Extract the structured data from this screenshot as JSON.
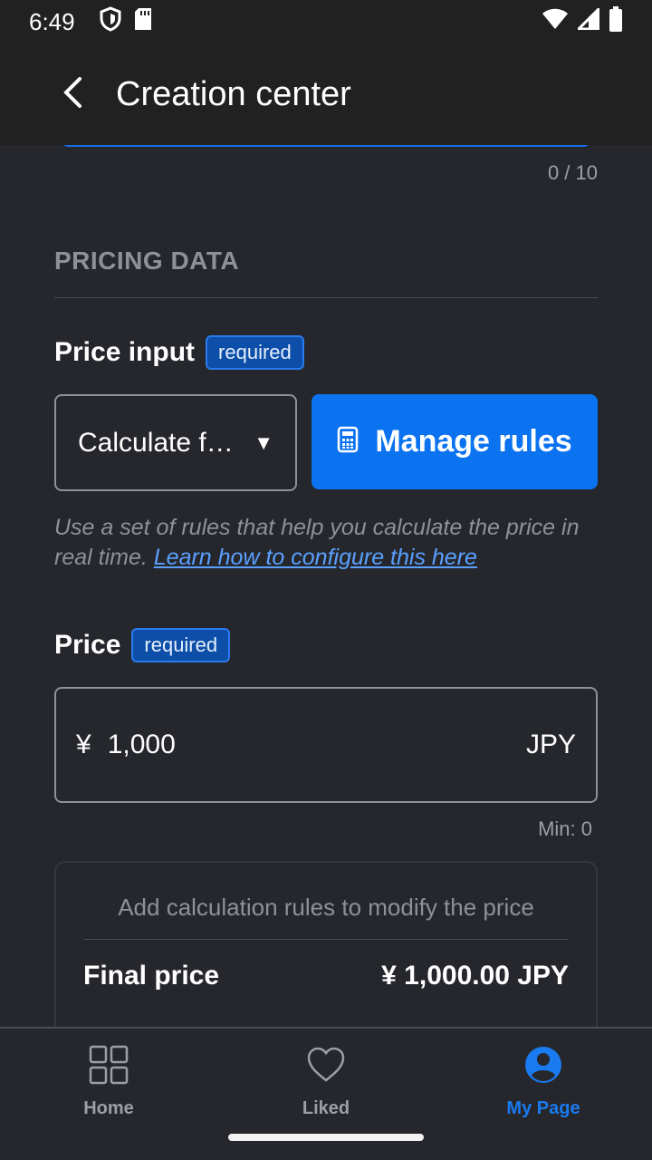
{
  "status_bar": {
    "time": "6:49"
  },
  "app_bar": {
    "title": "Creation center"
  },
  "previous_field": {
    "counter": "0 / 10"
  },
  "pricing_section": {
    "title": "PRICING DATA",
    "price_input": {
      "label": "Price input",
      "badge": "required",
      "dropdown_value": "Calculate f…",
      "manage_button_label": "Manage rules",
      "helper_text": "Use a set of rules that help you calculate the price in real time.",
      "helper_link": "Learn how to configure this here"
    },
    "price": {
      "label": "Price",
      "badge": "required",
      "currency_symbol": "¥",
      "value": "1,000",
      "currency_code": "JPY",
      "min_text": "Min: 0"
    },
    "summary": {
      "hint": "Add calculation rules to modify the price",
      "final_label": "Final price",
      "final_value": "¥ 1,000.00 JPY"
    }
  },
  "bottom_nav": {
    "items": [
      {
        "label": "Home",
        "icon": "grid-icon",
        "active": false
      },
      {
        "label": "Liked",
        "icon": "heart-icon",
        "active": false
      },
      {
        "label": "My Page",
        "icon": "user-circle-icon",
        "active": true
      }
    ]
  },
  "colors": {
    "accent": "#0b72f0",
    "background": "#25272c",
    "app_bar": "#212121"
  }
}
